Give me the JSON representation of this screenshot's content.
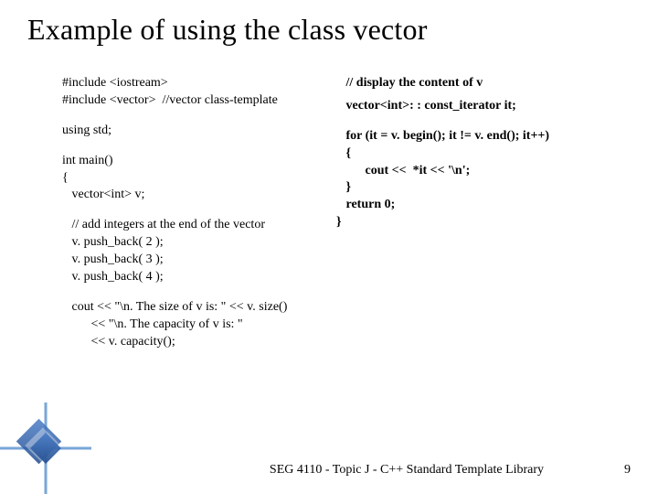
{
  "title": "Example of using the class vector",
  "left": {
    "l1": "#include <iostream>",
    "l2": "#include <vector>  //vector class-template",
    "l3": "using std;",
    "l4": "int main()",
    "l5": "{",
    "l6": "   vector<int> v;",
    "l7": "   // add integers at the end of the vector",
    "l8": "   v. push_back( 2 );",
    "l9": "   v. push_back( 3 );",
    "l10": "   v. push_back( 4 );",
    "l11": "   cout << \"\\n. The size of v is: \" << v. size()",
    "l12": "         << \"\\n. The capacity of v is: \"",
    "l13": "         << v. capacity();"
  },
  "right": {
    "r1": "   // display the content of v",
    "r2": "   vector<int>: : const_iterator it;",
    "r3": "   for (it = v. begin(); it != v. end(); it++)",
    "r4": "   {",
    "r5": "         cout <<  *it << '\\n';",
    "r6": "   }",
    "r7": "   return 0;",
    "r8": "}"
  },
  "footer": "SEG 4110 - Topic J - C++ Standard Template Library",
  "page": "9"
}
